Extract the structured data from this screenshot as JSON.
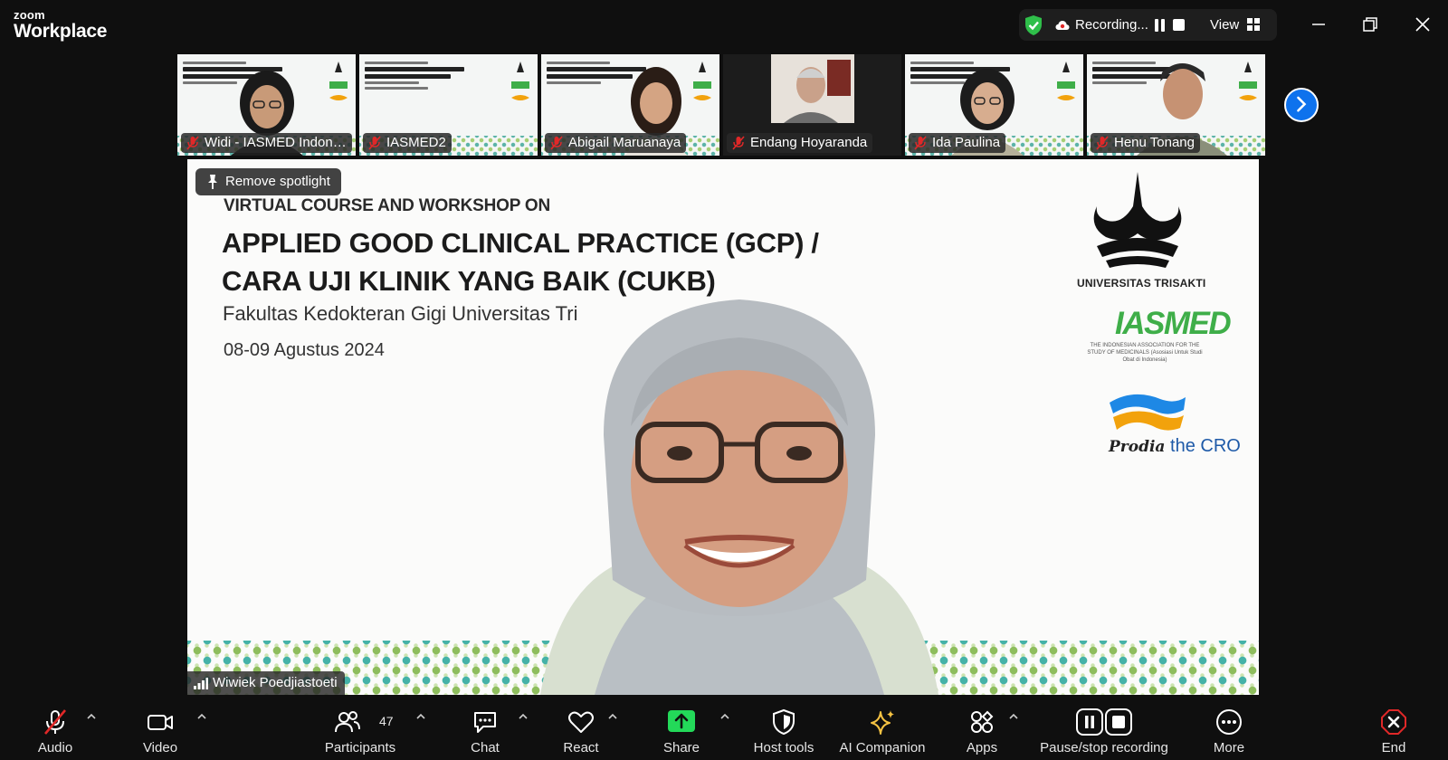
{
  "app": {
    "brand_small": "zoom",
    "brand_large": "Workplace"
  },
  "recording": {
    "status_label": "Recording...",
    "view_label": "View"
  },
  "thumbnails": [
    {
      "name": "Widi - IASMED Indone...",
      "muted": true
    },
    {
      "name": "IASMED2",
      "muted": true
    },
    {
      "name": "Abigail Maruanaya",
      "muted": true
    },
    {
      "name": "Endang Hoyaranda",
      "muted": true
    },
    {
      "name": "Ida Paulina",
      "muted": true
    },
    {
      "name": "Henu Tonang",
      "muted": true
    }
  ],
  "stage": {
    "spotlight_label": "Remove spotlight",
    "slide": {
      "subtitle": "VIRTUAL COURSE AND WORKSHOP ON",
      "title_line1": "APPLIED GOOD CLINICAL PRACTICE (GCP) /",
      "title_line2": "CARA UJI KLINIK YANG BAIK (CUKB)",
      "faculty": "Fakultas Kedokteran Gigi Universitas Tri",
      "date": "08-09 Agustus 2024",
      "logo_uni": "UNIVERSITAS TRISAKTI",
      "logo_iasmed": "IASMED",
      "logo_iasmed_sub": "THE INDONESIAN ASSOCIATION FOR THE STUDY OF MEDICINALS (Asosiasi Untuk Studi Obat di Indonesia)",
      "logo_cro_brand": "Prodia",
      "logo_cro_suffix": "the CRO"
    },
    "speaker_name": "Wiwiek Poedjiastoeti"
  },
  "toolbar": {
    "audio": "Audio",
    "video": "Video",
    "participants": "Participants",
    "participants_count": "47",
    "chat": "Chat",
    "react": "React",
    "share": "Share",
    "host_tools": "Host tools",
    "ai_companion": "AI Companion",
    "apps": "Apps",
    "pause_stop": "Pause/stop recording",
    "more": "More",
    "end": "End"
  },
  "colors": {
    "share_green": "#23d959",
    "end_red": "#e02828",
    "ai_yellow": "#f6c343",
    "accent_blue": "#0e72ed",
    "shield_green": "#2fbf4a"
  }
}
